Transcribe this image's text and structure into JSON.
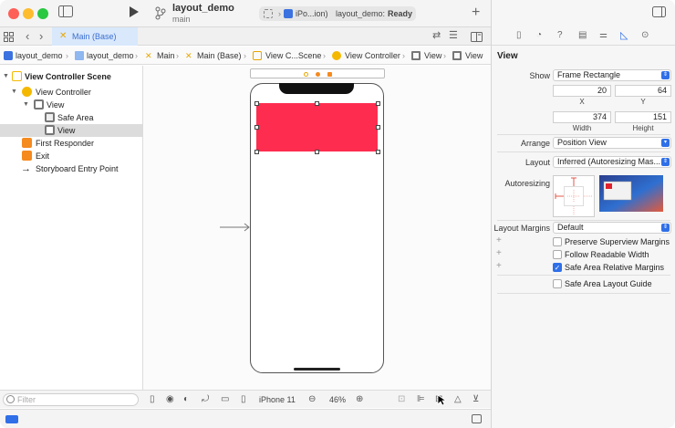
{
  "window": {
    "project_name": "layout_demo",
    "branch": "main",
    "scheme": "iPo...ion)",
    "status_project": "layout_demo:",
    "status_state": "Ready"
  },
  "editor_tab": {
    "label": "Main (Base)"
  },
  "breadcrumb": [
    "layout_demo",
    "layout_demo",
    "Main",
    "Main (Base)",
    "View C...Scene",
    "View Controller",
    "View",
    "View"
  ],
  "navigator": {
    "items": [
      {
        "label": "View Controller Scene",
        "bold": true
      },
      {
        "label": "View Controller"
      },
      {
        "label": "View"
      },
      {
        "label": "Safe Area"
      },
      {
        "label": "View"
      },
      {
        "label": "First Responder"
      },
      {
        "label": "Exit"
      },
      {
        "label": "Storyboard Entry Point"
      }
    ],
    "filter_placeholder": "Filter"
  },
  "canvas_toolbar": {
    "device": "iPhone 11",
    "zoom": "46%"
  },
  "inspector": {
    "section_title": "View",
    "show_label": "Show",
    "show_value": "Frame Rectangle",
    "x": "20",
    "y": "64",
    "x_label": "X",
    "y_label": "Y",
    "width": "374",
    "height": "151",
    "width_label": "Width",
    "height_label": "Height",
    "arrange_label": "Arrange",
    "arrange_value": "Position View",
    "layout_label": "Layout",
    "layout_value": "Inferred (Autoresizing Mas...",
    "autoresizing_label": "Autoresizing",
    "layout_margins_label": "Layout Margins",
    "layout_margins_value": "Default",
    "checkboxes": [
      {
        "label": "Preserve Superview Margins",
        "checked": false
      },
      {
        "label": "Follow Readable Width",
        "checked": false
      },
      {
        "label": "Safe Area Relative Margins",
        "checked": true
      },
      {
        "label": "Safe Area Layout Guide",
        "checked": false
      }
    ]
  },
  "colors": {
    "accent": "#2f6fe8",
    "red_view": "#fe2d4f",
    "scene_icon": "#f5b800"
  }
}
